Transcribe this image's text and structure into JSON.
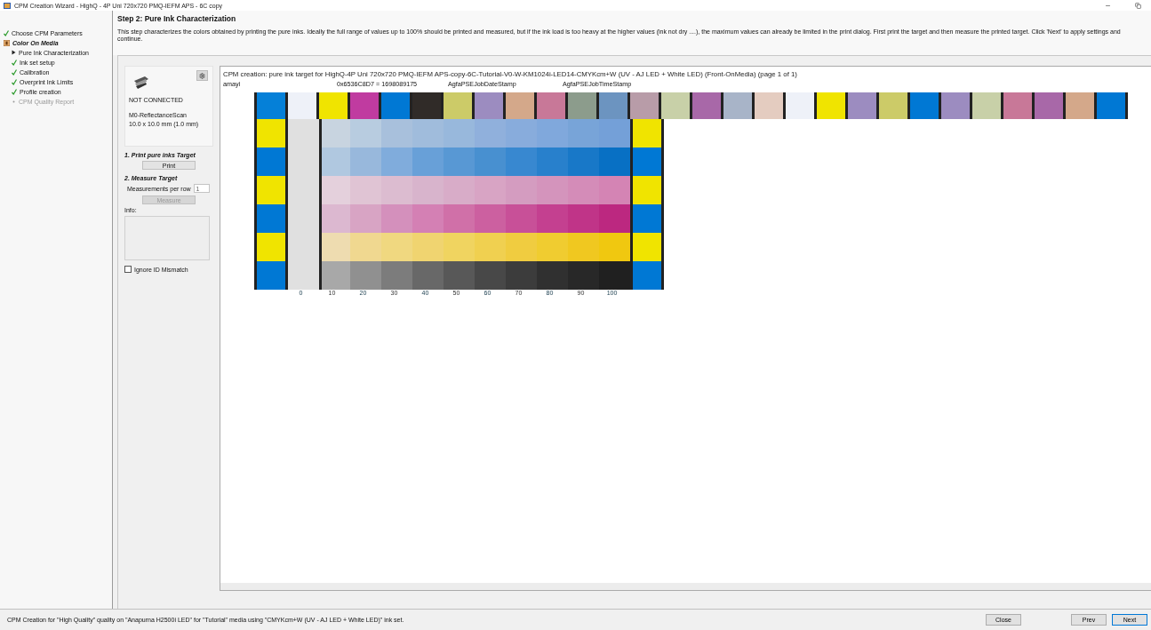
{
  "window": {
    "title": "CPM Creation Wizard - HighQ - 4P Uni 720x720 PMQ-IEFM APS - 6C copy"
  },
  "sidebar": {
    "items": [
      {
        "label": "Choose CPM Parameters",
        "kind": "done"
      },
      {
        "label": "Color On Media",
        "kind": "group",
        "children": [
          {
            "label": "Pure Ink Characterization",
            "kind": "current"
          },
          {
            "label": "Ink set setup",
            "kind": "done"
          },
          {
            "label": "Calibration",
            "kind": "done"
          },
          {
            "label": "Overprint Ink Limits",
            "kind": "done"
          },
          {
            "label": "Profile creation",
            "kind": "done"
          },
          {
            "label": "CPM Quality Report",
            "kind": "pending"
          }
        ]
      }
    ]
  },
  "header": {
    "title": "Step 2: Pure Ink Characterization",
    "description": "This step characterizes the colors obtained by printing the pure inks.  Ideally the full range of values up to 100% should be printed and measured, but if the ink load is too heavy at the higher values (ink not dry ....), the maximum values can already be limited in the print dialog.  First print the target and then measure the printed target.  Click 'Next' to apply settings and continue."
  },
  "device": {
    "status": "NOT CONNECTED",
    "mode": "M0-ReflectanceScan",
    "aperture": "10.0 x 10.0 mm (1.0 mm)",
    "print_heading": "1. Print pure inks Target",
    "print_button": {
      "label": "Print",
      "disabled": false
    },
    "measure_heading": "2. Measure Target",
    "per_row_label": "Measurements per row",
    "per_row_value": "1",
    "measure_button": {
      "label": "Measure",
      "disabled": true
    },
    "info_label": "Info:",
    "ignore_mismatch": {
      "label": "Ignore ID Mismatch",
      "checked": false
    }
  },
  "target": {
    "title": "CPM creation: pure ink target for HighQ-4P Uni 720x720 PMQ-IEFM APS-copy-6C-Tutorial-V0-W-KM1024i-LED14-CMYKcm+W (UV - AJ LED + White LED) (Front-OnMedia) (page 1 of 1)",
    "meta": [
      "amayi",
      "0x6536C8D7 = 1698089175",
      "AgfaPSEJobDateStamp",
      "AgfaPSEJobTimeStamp"
    ],
    "top_row": [
      {
        "color": "#0580d8"
      },
      {
        "color": "#eef1f8"
      },
      {
        "color": "#f0e400"
      },
      {
        "color": "#c03ba0"
      },
      {
        "color": "#0078d4"
      },
      {
        "color": "#302b28"
      },
      {
        "color": "#cccb68"
      },
      {
        "color": "#9c8cc0"
      },
      {
        "color": "#d4a88a"
      },
      {
        "color": "#c87898"
      },
      {
        "color": "#8c9c8c"
      },
      {
        "color": "#6c94c0"
      },
      {
        "color": "#b89ca8"
      },
      {
        "color": "#c8d0a8"
      },
      {
        "color": "#a868a8"
      },
      {
        "color": "#a8b4c8"
      },
      {
        "color": "#e4ccc0"
      },
      {
        "color": "#eef1f8"
      },
      {
        "color": "#f0e400"
      },
      {
        "color": "#9c8cc0"
      },
      {
        "color": "#cccb68"
      },
      {
        "color": "#0078d4"
      },
      {
        "color": "#9c8cc0"
      },
      {
        "color": "#c8d0a8"
      },
      {
        "color": "#c87898"
      },
      {
        "color": "#a868a8"
      },
      {
        "color": "#d4a88a"
      },
      {
        "color": "#0078d4"
      }
    ],
    "rows": [
      {
        "cells": [
          {
            "color": "#f0e400"
          },
          {
            "color": "#e0e0e0"
          },
          {
            "color": "#c8d4e0"
          },
          {
            "color": "#b8cce0"
          },
          {
            "color": "#a8c0dc"
          },
          {
            "color": "#a0bcdc"
          },
          {
            "color": "#98b8dc"
          },
          {
            "color": "#90b0dc"
          },
          {
            "color": "#88acdc"
          },
          {
            "color": "#80a8dc"
          },
          {
            "color": "#78a4d8"
          },
          {
            "color": "#74a0d8"
          },
          {
            "color": "#f0e400"
          }
        ]
      },
      {
        "cells": [
          {
            "color": "#0078d4"
          },
          {
            "color": "#e0e0e0"
          },
          {
            "color": "#b0c8e0"
          },
          {
            "color": "#98b8dc"
          },
          {
            "color": "#80acdc"
          },
          {
            "color": "#68a0d8"
          },
          {
            "color": "#5898d4"
          },
          {
            "color": "#4890d0"
          },
          {
            "color": "#3888d0"
          },
          {
            "color": "#2880cc"
          },
          {
            "color": "#1878c8"
          },
          {
            "color": "#0870c4"
          },
          {
            "color": "#0078d4"
          }
        ]
      },
      {
        "cells": [
          {
            "color": "#f0e400"
          },
          {
            "color": "#e0e0e0"
          },
          {
            "color": "#e4d0dc"
          },
          {
            "color": "#e0c4d4"
          },
          {
            "color": "#dcbcd0"
          },
          {
            "color": "#d8b4cc"
          },
          {
            "color": "#d8acc8"
          },
          {
            "color": "#d8a4c4"
          },
          {
            "color": "#d49cc0"
          },
          {
            "color": "#d494bc"
          },
          {
            "color": "#d48cb8"
          },
          {
            "color": "#d484b4"
          },
          {
            "color": "#f0e400"
          }
        ]
      },
      {
        "cells": [
          {
            "color": "#0078d4"
          },
          {
            "color": "#e0e0e0"
          },
          {
            "color": "#dcb8d0"
          },
          {
            "color": "#d8a4c4"
          },
          {
            "color": "#d490bc"
          },
          {
            "color": "#d480b4"
          },
          {
            "color": "#d070a8"
          },
          {
            "color": "#cc60a0"
          },
          {
            "color": "#c85098"
          },
          {
            "color": "#c44090"
          },
          {
            "color": "#c03488"
          },
          {
            "color": "#bc2880"
          },
          {
            "color": "#0078d4"
          }
        ]
      },
      {
        "cells": [
          {
            "color": "#f0e400"
          },
          {
            "color": "#e0e0e0"
          },
          {
            "color": "#eedcb0"
          },
          {
            "color": "#f0d890"
          },
          {
            "color": "#f0d880"
          },
          {
            "color": "#f0d470"
          },
          {
            "color": "#f0d460"
          },
          {
            "color": "#f0d050"
          },
          {
            "color": "#f0cc40"
          },
          {
            "color": "#f0cc30"
          },
          {
            "color": "#f0c820"
          },
          {
            "color": "#f0c810"
          },
          {
            "color": "#f0e400"
          }
        ]
      },
      {
        "cells": [
          {
            "color": "#0078d4"
          },
          {
            "color": "#e0e0e0"
          },
          {
            "color": "#a8a8a8"
          },
          {
            "color": "#909090"
          },
          {
            "color": "#7c7c7c"
          },
          {
            "color": "#686868"
          },
          {
            "color": "#585858"
          },
          {
            "color": "#484848"
          },
          {
            "color": "#3c3c3c"
          },
          {
            "color": "#303030"
          },
          {
            "color": "#282828"
          },
          {
            "color": "#202020"
          },
          {
            "color": "#0078d4"
          }
        ]
      }
    ],
    "ticks": [
      "0",
      "10",
      "20",
      "30",
      "40",
      "50",
      "60",
      "70",
      "80",
      "90",
      "100"
    ]
  },
  "status_bar": {
    "text": "CPM Creation for \"High Quality\" quality on \"Anapurna H2500i LED\" for \"Tutorial\" media using \"CMYKcm+W (UV - AJ LED + White LED)\" ink set."
  },
  "buttons": [
    {
      "label": "Close",
      "default": false
    },
    {
      "label": "Prev",
      "default": false
    },
    {
      "label": "Next",
      "default": true
    }
  ]
}
